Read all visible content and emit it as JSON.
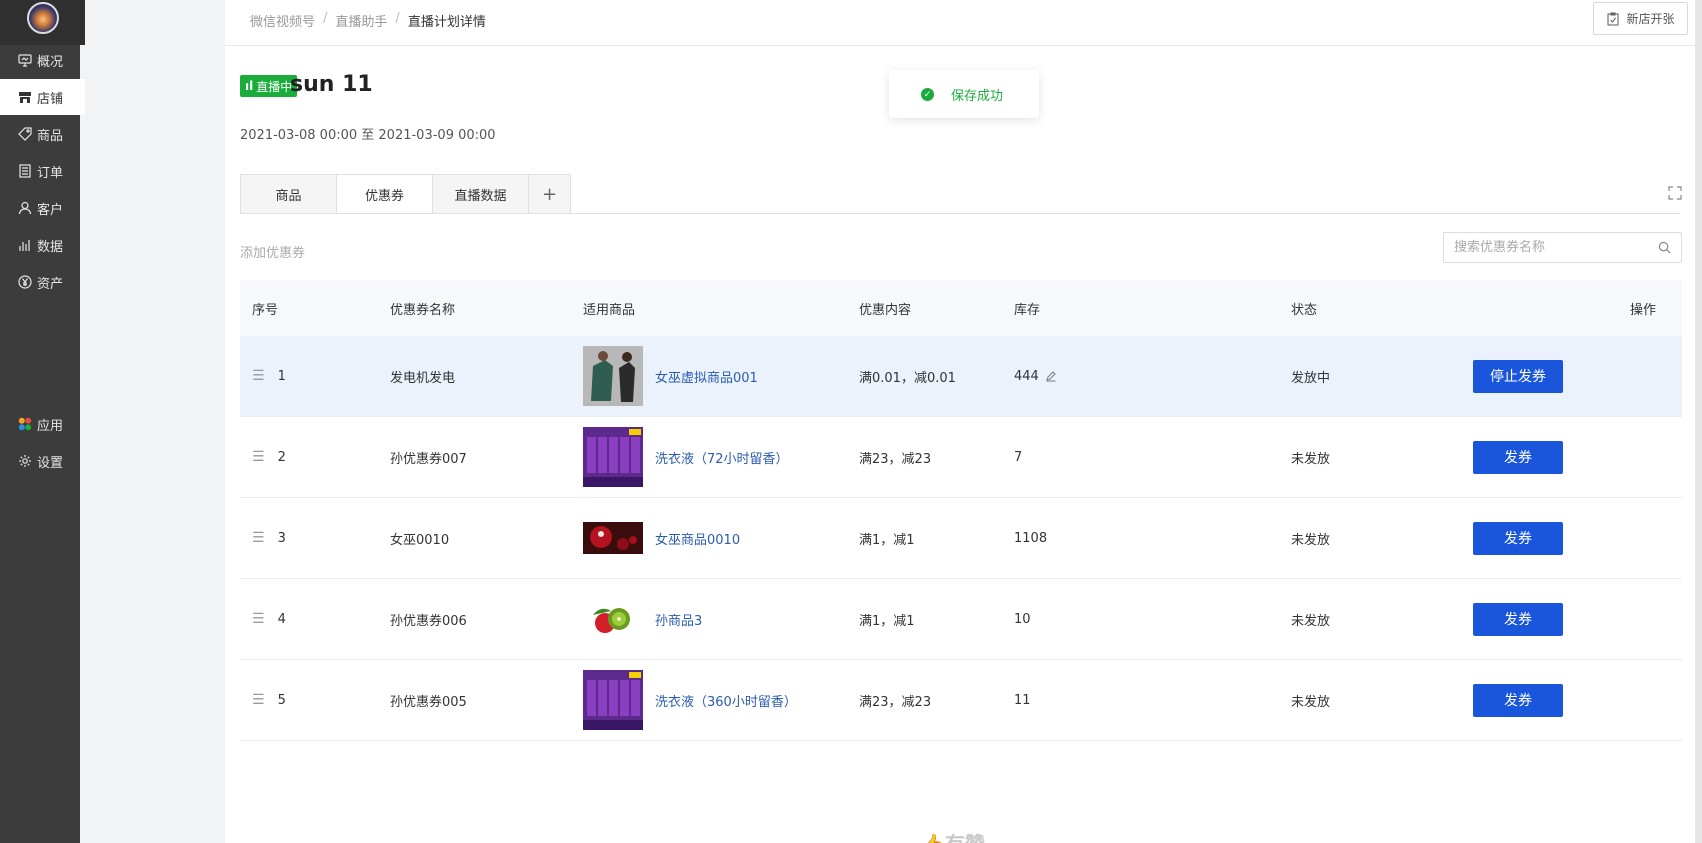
{
  "sidebar": {
    "items": [
      {
        "label": "概况",
        "icon": "monitor-icon",
        "active": false
      },
      {
        "label": "店铺",
        "icon": "store-icon",
        "active": true
      },
      {
        "label": "商品",
        "icon": "tag-icon",
        "active": false
      },
      {
        "label": "订单",
        "icon": "list-icon",
        "active": false
      },
      {
        "label": "客户",
        "icon": "user-icon",
        "active": false
      },
      {
        "label": "数据",
        "icon": "bar-chart-icon",
        "active": false
      },
      {
        "label": "资产",
        "icon": "yen-icon",
        "active": false
      },
      {
        "label": "应用",
        "icon": "apps-icon",
        "active": false
      },
      {
        "label": "设置",
        "icon": "gear-icon",
        "active": false
      }
    ]
  },
  "breadcrumb": {
    "items": [
      "微信视频号",
      "直播助手",
      "直播计划详情"
    ],
    "separator": "/"
  },
  "header": {
    "newshop_label": "新店开张"
  },
  "plan": {
    "live_badge": "直播中",
    "title": "sun 11",
    "time_range": "2021-03-08 00:00 至 2021-03-09 00:00"
  },
  "toast": {
    "message": "保存成功"
  },
  "tabs": [
    {
      "label": "商品",
      "active": false
    },
    {
      "label": "优惠券",
      "active": true
    },
    {
      "label": "直播数据",
      "active": false
    },
    {
      "label": "+",
      "active": false
    }
  ],
  "toolbar": {
    "add_coupon": "添加优惠券",
    "search_placeholder": "搜索优惠券名称"
  },
  "table": {
    "columns": [
      "序号",
      "优惠券名称",
      "适用商品",
      "优惠内容",
      "库存",
      "状态",
      "操作"
    ],
    "rows": [
      {
        "index": "1",
        "name": "发电机发电",
        "product": "女巫虚拟商品001",
        "content": "满0.01，减0.01",
        "stock": "444",
        "status": "发放中",
        "action": "停止发券"
      },
      {
        "index": "2",
        "name": "孙优惠券007",
        "product": "洗衣液（72小时留香）",
        "content": "满23，减23",
        "stock": "7",
        "status": "未发放",
        "action": "发券"
      },
      {
        "index": "3",
        "name": "女巫0010",
        "product": "女巫商品0010",
        "content": "满1，减1",
        "stock": "1108",
        "status": "未发放",
        "action": "发券"
      },
      {
        "index": "4",
        "name": "孙优惠券006",
        "product": "孙商品3",
        "content": "满1，减1",
        "stock": "10",
        "status": "未发放",
        "action": "发券"
      },
      {
        "index": "5",
        "name": "孙优惠券005",
        "product": "洗衣液（360小时留香）",
        "content": "满23，减23",
        "stock": "11",
        "status": "未发放",
        "action": "发券"
      }
    ]
  },
  "footer": {
    "brand": "有赞"
  },
  "colors": {
    "sidebar_bg": "#3c3c3c",
    "live_green": "#1aad3c",
    "primary_button": "#1a56db",
    "link_blue": "#2a5db0",
    "highlight_row": "#ebf2fc"
  }
}
